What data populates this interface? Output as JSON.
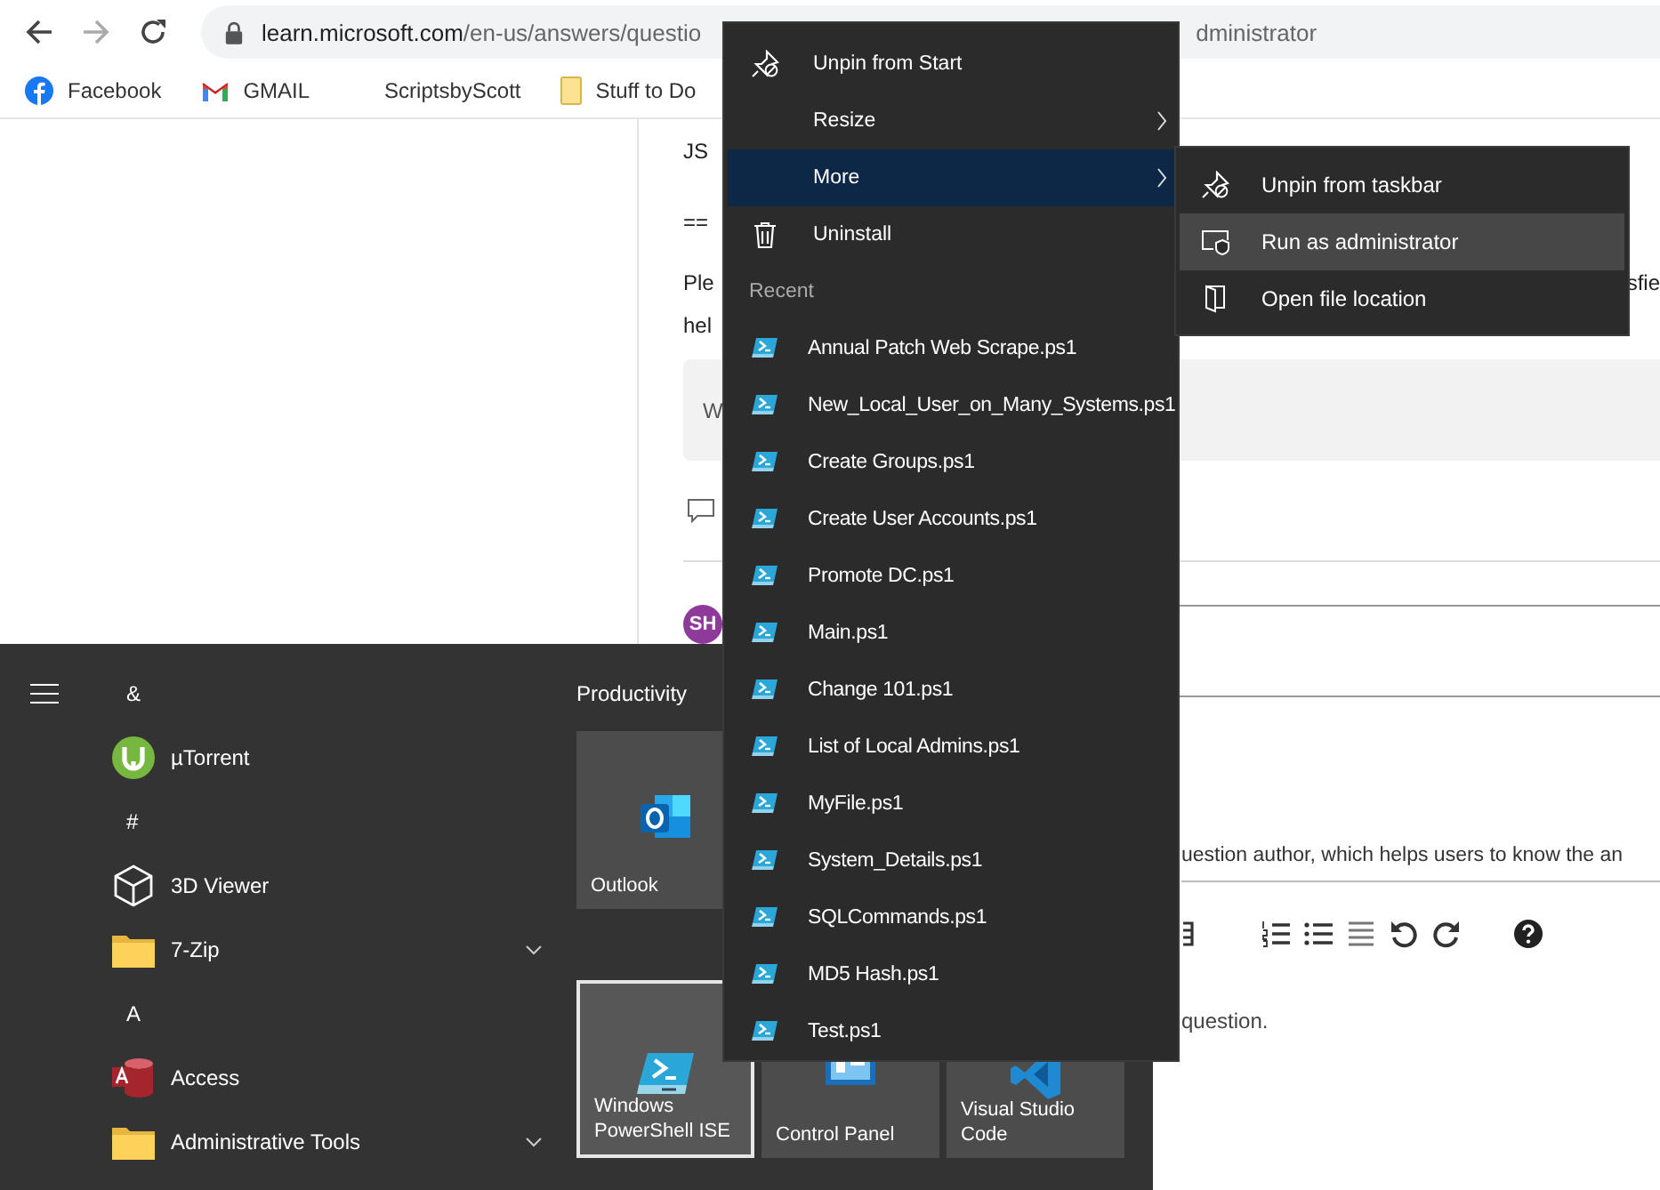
{
  "browser": {
    "url_host": "learn.microsoft.com",
    "url_path": "/en-us/answers/questio",
    "url_tail": "dministrator",
    "bookmarks": [
      {
        "label": "Facebook",
        "kind": "facebook"
      },
      {
        "label": "GMAIL",
        "kind": "gmail"
      },
      {
        "label": "ScriptsbyScott",
        "kind": "blank"
      },
      {
        "label": "Stuff to Do",
        "kind": "folder"
      }
    ]
  },
  "page": {
    "lines": [
      {
        "left": "JS"
      },
      {
        "left": "=="
      },
      {
        "left": "Ple",
        "right": "sfie"
      },
      {
        "left": "hel"
      }
    ],
    "quote": "W",
    "avatar": "SH",
    "notice": "uestion author, which helps users to know the an",
    "editor_placeholder": "question."
  },
  "start_menu": {
    "apps": [
      {
        "kind": "letter",
        "label": "&"
      },
      {
        "kind": "app",
        "label": "µTorrent"
      },
      {
        "kind": "letter",
        "label": "#"
      },
      {
        "kind": "app",
        "label": "3D Viewer"
      },
      {
        "kind": "folder",
        "label": "7-Zip",
        "expanded": false
      },
      {
        "kind": "letter",
        "label": "A"
      },
      {
        "kind": "app",
        "label": "Access"
      },
      {
        "kind": "folder",
        "label": "Administrative Tools",
        "expanded": false
      }
    ],
    "group": "Productivity",
    "tile_rows": [
      [
        {
          "label": "Outlook",
          "selected": false
        }
      ],
      [
        {
          "label": "Windows PowerShell ISE",
          "selected": true
        },
        {
          "label": "Control Panel",
          "selected": false
        },
        {
          "label": "Visual Studio Code",
          "selected": false
        }
      ]
    ]
  },
  "context_menu": {
    "items": [
      {
        "label": "Unpin from Start",
        "submenu": false,
        "selected": false
      },
      {
        "label": "Resize",
        "submenu": true,
        "selected": false
      },
      {
        "label": "More",
        "submenu": true,
        "selected": true
      },
      {
        "label": "Uninstall",
        "submenu": false,
        "selected": false
      }
    ],
    "section": "Recent",
    "recent": [
      "Annual Patch Web Scrape.ps1",
      "New_Local_User_on_Many_Systems.ps1",
      "Create Groups.ps1",
      "Create User Accounts.ps1",
      "Promote DC.ps1",
      "Main.ps1",
      "Change 101.ps1",
      "List of Local Admins.ps1",
      "MyFile.ps1",
      "System_Details.ps1",
      "SQLCommands.ps1",
      "MD5 Hash.ps1",
      "Test.ps1"
    ]
  },
  "submenu": {
    "items": [
      {
        "label": "Unpin from taskbar",
        "selected": false
      },
      {
        "label": "Run as administrator",
        "selected": true
      },
      {
        "label": "Open file location",
        "selected": false
      }
    ]
  }
}
